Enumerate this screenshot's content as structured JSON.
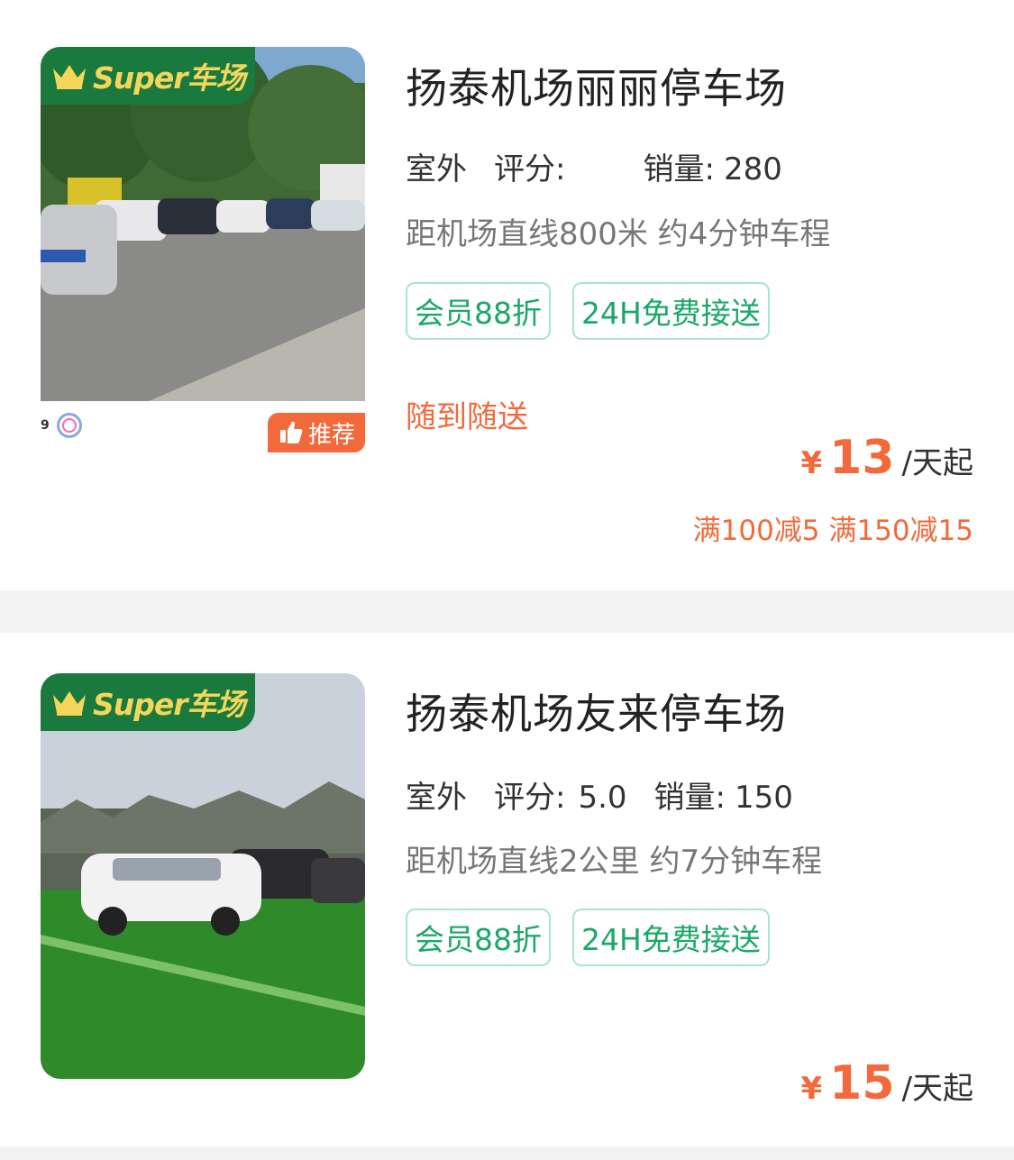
{
  "listings": [
    {
      "badge": "Super车场",
      "title": "扬泰机场丽丽停车场",
      "type": "室外",
      "rating_label": "评分:",
      "rating": "",
      "sales_label": "销量:",
      "sales": "280",
      "distance": "距机场直线800米 约4分钟车程",
      "tags": [
        "会员88折",
        "24H免费接送"
      ],
      "photo_logo_text": "9",
      "recommend": "推荐",
      "delivery": "随到随送",
      "currency": "¥",
      "price": "13",
      "price_unit": "/天起",
      "promo": "满100减5 满150减15"
    },
    {
      "badge": "Super车场",
      "title": "扬泰机场友来停车场",
      "type": "室外",
      "rating_label": "评分:",
      "rating": "5.0",
      "sales_label": "销量:",
      "sales": "150",
      "distance": "距机场直线2公里 约7分钟车程",
      "tags": [
        "会员88折",
        "24H免费接送"
      ],
      "currency": "¥",
      "price": "15",
      "price_unit": "/天起"
    }
  ],
  "colors": {
    "brand_green": "#1a7a3e",
    "tag_green": "#1aa868",
    "accent_orange": "#f26a3c"
  },
  "icons": {
    "badge_icon": "crown-icon",
    "recommend_icon": "thumbs-up-icon"
  }
}
